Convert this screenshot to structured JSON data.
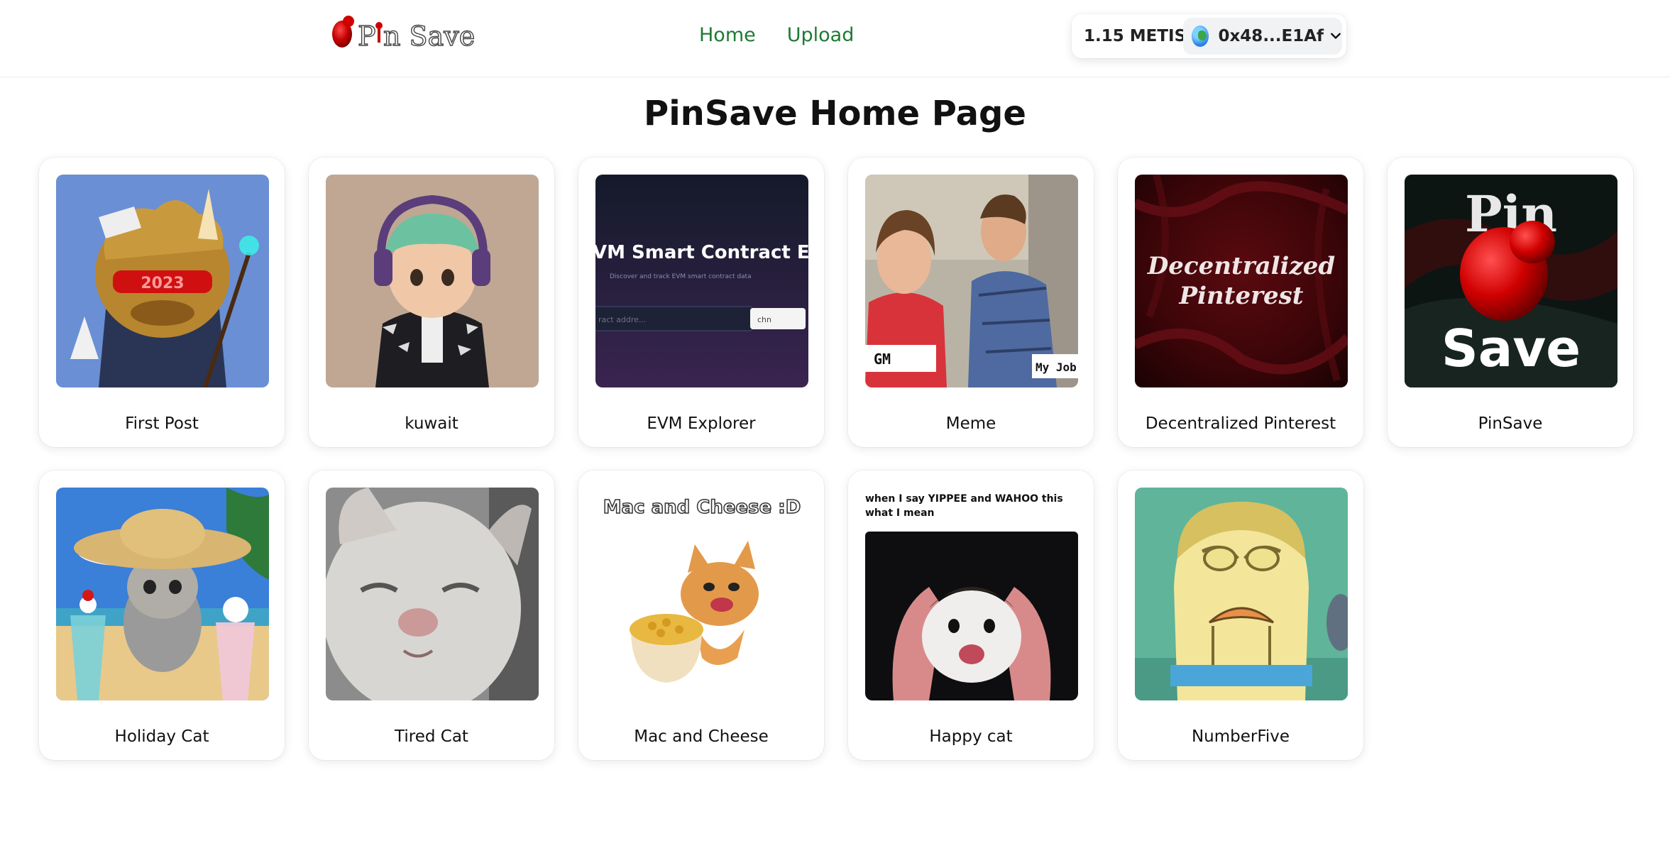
{
  "brand": {
    "name": "PinSave",
    "logo_text_a": "P",
    "logo_text_b": "n Save"
  },
  "nav": {
    "home": "Home",
    "upload": "Upload"
  },
  "wallet": {
    "balance": "1.15 METIS",
    "address": "0x48...E1Af",
    "avatar_icon": "globe-avatar-icon",
    "chevron_icon": "chevron-down-icon"
  },
  "page": {
    "title": "PinSave Home Page"
  },
  "posts": [
    {
      "title": "First Post"
    },
    {
      "title": "kuwait"
    },
    {
      "title": "EVM Explorer",
      "thumb_text": "VM Smart Contract Expl",
      "thumb_sub": "Discover and track EVM smart contract data",
      "thumb_input": "ract addre...",
      "thumb_select": "chn"
    },
    {
      "title": "Meme",
      "thumb_label_a": "GM",
      "thumb_label_b": "My Job"
    },
    {
      "title": "Decentralized Pinterest",
      "thumb_line_a": "Decentralized",
      "thumb_line_b": "Pinterest"
    },
    {
      "title": "PinSave",
      "thumb_line_a": "Pin",
      "thumb_line_b": "Save"
    },
    {
      "title": "Holiday Cat"
    },
    {
      "title": "Tired Cat"
    },
    {
      "title": "Mac and Cheese",
      "thumb_caption": "Mac and Cheese :D"
    },
    {
      "title": "Happy cat",
      "thumb_caption_a": "when I say YIPPEE and WAHOO this",
      "thumb_caption_b": "what I mean"
    },
    {
      "title": "NumberFive"
    }
  ]
}
